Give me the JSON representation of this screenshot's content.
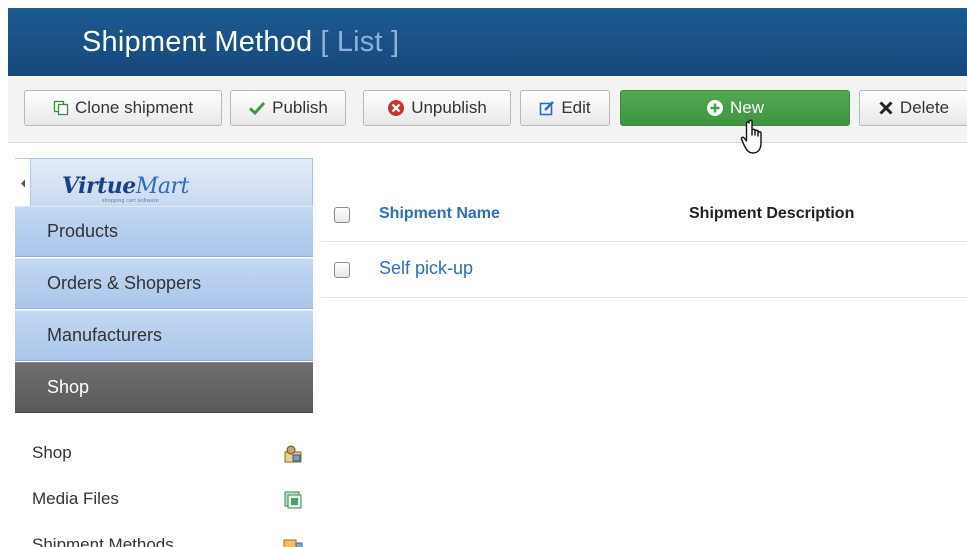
{
  "header": {
    "title": "Shipment Method",
    "subtitle": "[ List ]"
  },
  "toolbar": {
    "clone_label": "Clone shipment",
    "publish_label": "Publish",
    "unpublish_label": "Unpublish",
    "edit_label": "Edit",
    "new_label": "New",
    "delete_label": "Delete"
  },
  "sidebar": {
    "logo_text_main": "Virtue",
    "logo_text_accent": "Mart",
    "logo_tagline": "shopping cart software",
    "menu": [
      {
        "label": "Products"
      },
      {
        "label": "Orders & Shoppers"
      },
      {
        "label": "Manufacturers"
      },
      {
        "label": "Shop",
        "active": true
      }
    ],
    "submenu": [
      {
        "label": "Shop",
        "icon": "shop-icon"
      },
      {
        "label": "Media Files",
        "icon": "media-files-icon"
      },
      {
        "label": "Shipment Methods",
        "icon": "shipment-methods-icon"
      }
    ]
  },
  "table": {
    "columns": {
      "name": "Shipment Name",
      "description": "Shipment Description"
    },
    "rows": [
      {
        "name": "Self pick-up",
        "description": ""
      }
    ]
  },
  "colors": {
    "header_bg": "#1d5a93",
    "new_button": "#4aa04a",
    "link": "#2a6fbe",
    "sidebar_item": "#b7cfee",
    "sidebar_active": "#646464"
  }
}
